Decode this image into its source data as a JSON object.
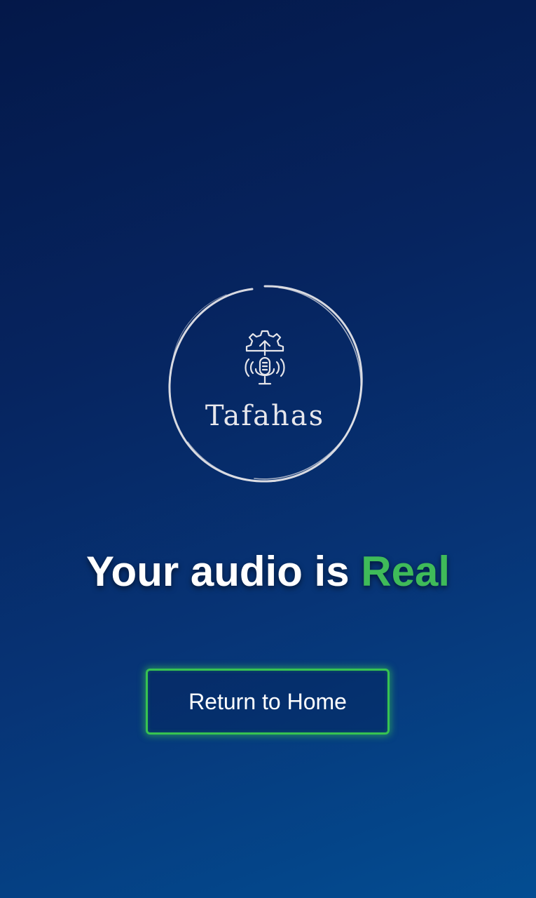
{
  "logo": {
    "wordmark": "Tafahas",
    "icon": "gear-microphone-icon",
    "ring_color": "#e4e4e8"
  },
  "result": {
    "prefix": "Your audio is ",
    "verdict": "Real",
    "verdict_color": "#3fbb59"
  },
  "actions": {
    "return_home_label": "Return to Home",
    "border_color": "#37c351"
  },
  "theme": {
    "background_top": "#041849",
    "background_bottom": "#034d92"
  }
}
